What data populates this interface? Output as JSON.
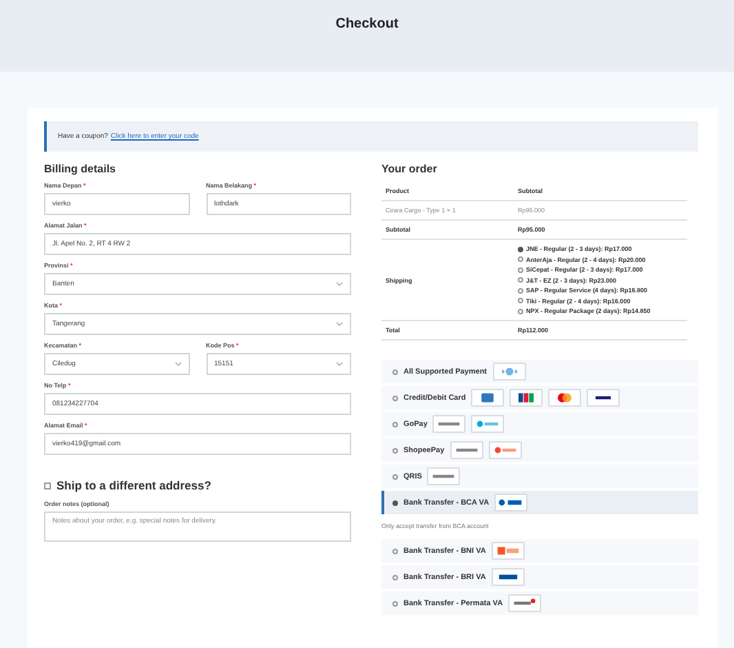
{
  "header": {
    "title": "Checkout"
  },
  "coupon": {
    "text": "Have a coupon?",
    "link": "Click here to enter your code"
  },
  "billing": {
    "title": "Billing details",
    "rows": [
      [
        {
          "label": "Nama Depan",
          "required_mark": "*",
          "kind": "input",
          "value": "vierko"
        },
        {
          "label": "Nama Belakang",
          "required_mark": "*",
          "kind": "input",
          "value": "lothdark"
        }
      ],
      [
        {
          "label": "Alamat Jalan",
          "required_mark": "*",
          "kind": "input",
          "value": "Jl. Apel No. 2, RT 4 RW 2"
        }
      ],
      [
        {
          "label": "Provinsi",
          "required_mark": "*",
          "kind": "select",
          "value": "Banten"
        }
      ],
      [
        {
          "label": "Kota",
          "required_mark": "*",
          "kind": "select",
          "value": "Tangerang"
        }
      ],
      [
        {
          "label": "Kecamatan",
          "required_mark": "*",
          "kind": "select",
          "value": "Ciledug"
        },
        {
          "label": "Kode Pos",
          "required_mark": "*",
          "kind": "select",
          "value": "15151"
        }
      ],
      [
        {
          "label": "No Telp",
          "required_mark": "*",
          "kind": "input",
          "value": "081234227704"
        }
      ],
      [
        {
          "label": "Alamat Email",
          "required_mark": "*",
          "kind": "input",
          "value": "vierko419@gmail.com"
        }
      ]
    ],
    "ship_different": {
      "label": "Ship to a different address?",
      "checked": false
    },
    "notes": {
      "label": "Order notes (optional)",
      "placeholder": "Notes about your order, e.g. special notes for delivery."
    }
  },
  "order": {
    "title": "Your order",
    "columns": [
      "Product",
      "Subtotal"
    ],
    "item": {
      "product": "Cirara Cargo - Type 1 × 1",
      "subtotal": "Rp95.000"
    },
    "subtotal": {
      "label": "Subtotal",
      "value": "Rp95.000"
    },
    "shipping": {
      "label": "Shipping",
      "options": [
        {
          "label": "JNE - Regular (2 - 3 days): Rp17.000",
          "selected": true
        },
        {
          "label": "AnterAja - Regular (2 - 4 days): Rp20.000",
          "selected": false
        },
        {
          "label": "SiCepat - Regular (2 - 3 days): Rp17.000",
          "selected": false
        },
        {
          "label": "J&T - EZ (2 - 3 days): Rp23.000",
          "selected": false
        },
        {
          "label": "SAP - Regular Service (4 days): Rp16.800",
          "selected": false
        },
        {
          "label": "Tiki - Regular (2 - 4 days): Rp16.000",
          "selected": false
        },
        {
          "label": "NPX - Regular Package (2 days): Rp14.850",
          "selected": false
        }
      ]
    },
    "total": {
      "label": "Total",
      "value": "Rp112.000"
    }
  },
  "payments": [
    {
      "label": "All Supported Payment",
      "selected": false,
      "logos": [
        {
          "kind": "all"
        }
      ]
    },
    {
      "label": "Credit/Debit Card",
      "selected": false,
      "logos": [
        {
          "kind": "amex"
        },
        {
          "kind": "jcb"
        },
        {
          "kind": "mastercard"
        },
        {
          "kind": "visa"
        }
      ]
    },
    {
      "label": "GoPay",
      "selected": false,
      "logos": [
        {
          "kind": "qris"
        },
        {
          "kind": "gopay"
        }
      ]
    },
    {
      "label": "ShopeePay",
      "selected": false,
      "logos": [
        {
          "kind": "qris"
        },
        {
          "kind": "shopeepay"
        }
      ]
    },
    {
      "label": "QRIS",
      "selected": false,
      "logos": [
        {
          "kind": "qris"
        }
      ]
    },
    {
      "label": "Bank Transfer - BCA VA",
      "selected": true,
      "logos": [
        {
          "kind": "bca"
        }
      ],
      "description": "Only accept transfer from BCA account"
    },
    {
      "label": "Bank Transfer - BNI VA",
      "selected": false,
      "logos": [
        {
          "kind": "bni"
        }
      ]
    },
    {
      "label": "Bank Transfer - BRI VA",
      "selected": false,
      "logos": [
        {
          "kind": "bri"
        }
      ]
    },
    {
      "label": "Bank Transfer - Permata VA",
      "selected": false,
      "logos": [
        {
          "kind": "permata"
        }
      ]
    }
  ]
}
